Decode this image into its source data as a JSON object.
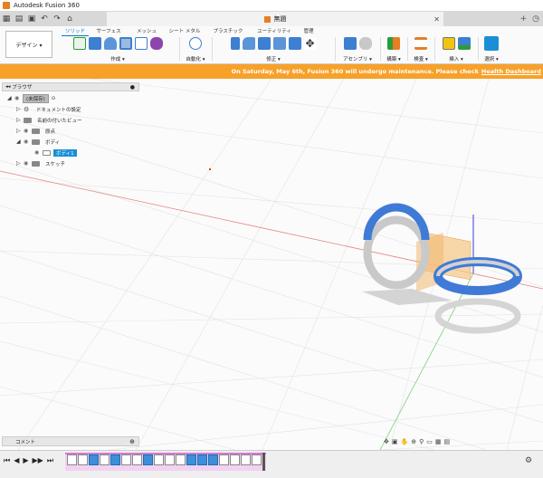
{
  "window": {
    "title": "Autodesk Fusion 360"
  },
  "document_tab": {
    "title": "無題"
  },
  "ribbon": {
    "workspace_label": "デザイン ▾",
    "tabs": [
      "ソリッド",
      "サーフェス",
      "メッシュ",
      "シート メタル",
      "プラスチック",
      "ユーティリティ",
      "管理"
    ],
    "groups": [
      "作成 ▾",
      "自動化 ▾",
      "修正 ▾",
      "アセンブリ ▾",
      "構築 ▾",
      "検査 ▾",
      "挿入 ▾",
      "選択 ▾"
    ]
  },
  "banner": {
    "message": "On Saturday, May 6th, Fusion 360 will undergo maintenance. Please check",
    "link": "Health Dashboard"
  },
  "browser": {
    "title": "ブラウザ",
    "root": "(未保存)",
    "items": [
      "ドキュメントの設定",
      "名前の付いたビュー",
      "原点",
      "ボディ",
      "ボディ1",
      "スケッチ"
    ]
  },
  "comments": {
    "title": "コメント"
  },
  "colors": {
    "accent": "#0e76c9",
    "banner": "#f7a12a",
    "selection": "#1b8fd6"
  }
}
